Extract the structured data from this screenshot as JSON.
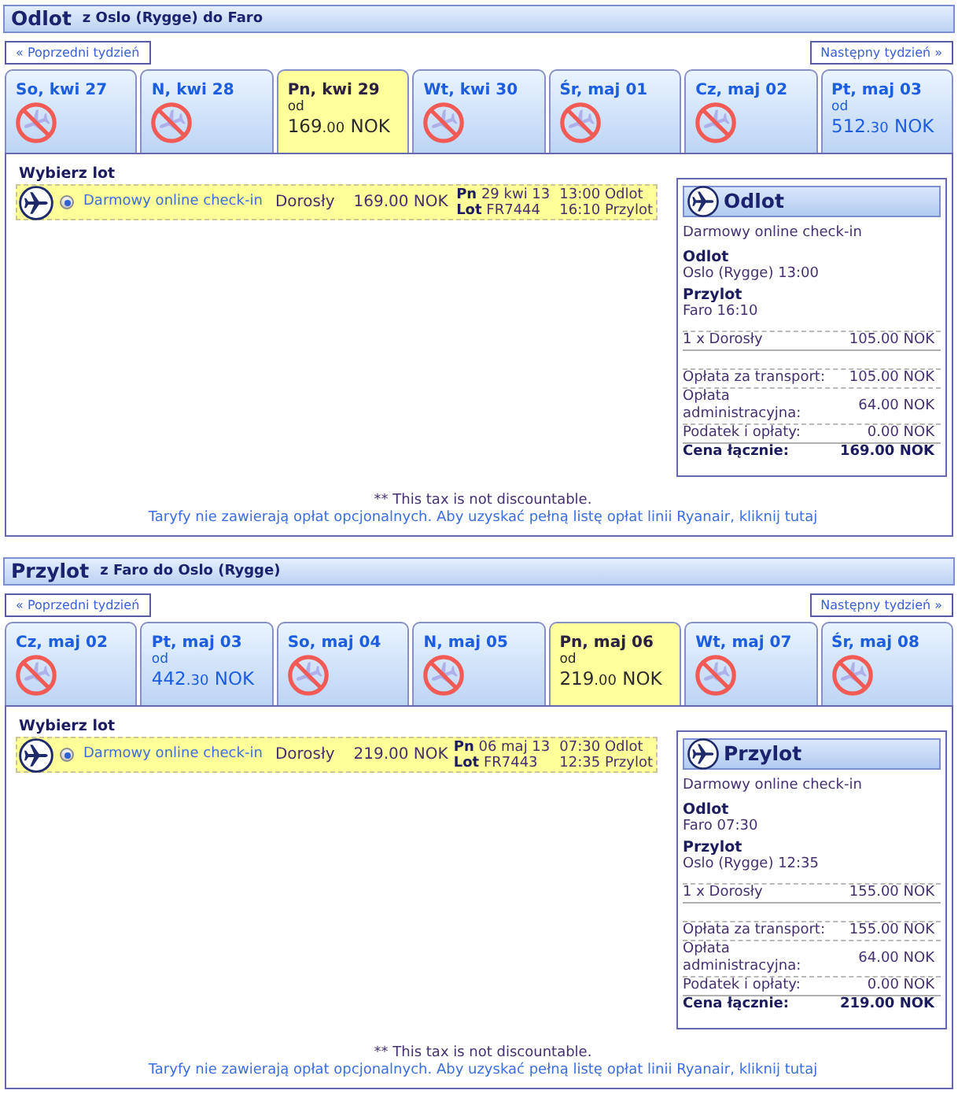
{
  "sections": [
    {
      "title": "Odlot",
      "route": "z Oslo (Rygge) do Faro",
      "prev_week": "« Poprzedni tydzień",
      "next_week": "Następny tydzień »",
      "days": [
        {
          "label": "So, kwi 27",
          "kind": "no_flights",
          "selected": false
        },
        {
          "label": "N, kwi 28",
          "kind": "no_flights",
          "selected": false
        },
        {
          "label": "Pn, kwi 29",
          "kind": "fare",
          "selected": true,
          "from": "od",
          "price_main": "169",
          "price_cents": ".00",
          "currency": "NOK"
        },
        {
          "label": "Wt, kwi 30",
          "kind": "no_flights",
          "selected": false
        },
        {
          "label": "Śr, maj 01",
          "kind": "no_flights",
          "selected": false
        },
        {
          "label": "Cz, maj 02",
          "kind": "no_flights",
          "selected": false
        },
        {
          "label": "Pt, maj 03",
          "kind": "fare",
          "selected": false,
          "from": "od",
          "price_main": "512",
          "price_cents": ".30",
          "currency": "NOK"
        }
      ],
      "flights_heading": "Wybierz lot",
      "flights": [
        {
          "selected": true,
          "fare_name": "Darmowy online check-in",
          "passenger": "Dorosły",
          "price": "169.00 NOK",
          "date": "**Pn** 29 kwi 13",
          "departure": "13:00 Odlot",
          "flight_no": "**Lot** FR7444",
          "arrival": "16:10 Przylot"
        }
      ],
      "summary": {
        "title": "Odlot",
        "fare_name": "Darmowy online check-in",
        "legs": [
          {
            "label": "Odlot",
            "value": "Oslo (Rygge) 13:00"
          },
          {
            "label": "Przylot",
            "value": "Faro 16:10"
          }
        ],
        "passengers": [
          {
            "label": "1 x Dorosły",
            "amount": "105.00 NOK"
          }
        ],
        "charges": [
          {
            "label": "Opłata za transport:",
            "amount": "105.00 NOK"
          },
          {
            "label": "Opłata administracyjna:",
            "amount": "64.00 NOK"
          },
          {
            "label": "Podatek i opłaty:",
            "amount": "0.00 NOK"
          }
        ],
        "total": {
          "label": "Cena łącznie:",
          "amount": "169.00 NOK"
        }
      },
      "tax_note": "** This tax is not discountable.",
      "fees_link": "Taryfy nie zawierają opłat opcjonalnych. Aby uzyskać pełną listę opłat linii Ryanair, kliknij tutaj"
    },
    {
      "title": "Przylot",
      "route": "z Faro do Oslo (Rygge)",
      "prev_week": "« Poprzedni tydzień",
      "next_week": "Następny tydzień »",
      "days": [
        {
          "label": "Cz, maj 02",
          "kind": "no_flights",
          "selected": false
        },
        {
          "label": "Pt, maj 03",
          "kind": "fare",
          "selected": false,
          "from": "od",
          "price_main": "442",
          "price_cents": ".30",
          "currency": "NOK"
        },
        {
          "label": "So, maj 04",
          "kind": "no_flights",
          "selected": false
        },
        {
          "label": "N, maj 05",
          "kind": "no_flights",
          "selected": false
        },
        {
          "label": "Pn, maj 06",
          "kind": "fare",
          "selected": true,
          "from": "od",
          "price_main": "219",
          "price_cents": ".00",
          "currency": "NOK"
        },
        {
          "label": "Wt, maj 07",
          "kind": "no_flights",
          "selected": false
        },
        {
          "label": "Śr, maj 08",
          "kind": "no_flights",
          "selected": false
        }
      ],
      "flights_heading": "Wybierz lot",
      "flights": [
        {
          "selected": true,
          "fare_name": "Darmowy online check-in",
          "passenger": "Dorosły",
          "price": "219.00 NOK",
          "date": "**Pn** 06 maj 13",
          "departure": "07:30 Odlot",
          "flight_no": "**Lot** FR7443",
          "arrival": "12:35 Przylot"
        }
      ],
      "summary": {
        "title": "Przylot",
        "fare_name": "Darmowy online check-in",
        "legs": [
          {
            "label": "Odlot",
            "value": "Faro 07:30"
          },
          {
            "label": "Przylot",
            "value": "Oslo (Rygge) 12:35"
          }
        ],
        "passengers": [
          {
            "label": "1 x Dorosły",
            "amount": "155.00 NOK"
          }
        ],
        "charges": [
          {
            "label": "Opłata za transport:",
            "amount": "155.00 NOK"
          },
          {
            "label": "Opłata administracyjna:",
            "amount": "64.00 NOK"
          },
          {
            "label": "Podatek i opłaty:",
            "amount": "0.00 NOK"
          }
        ],
        "total": {
          "label": "Cena łącznie:",
          "amount": "219.00 NOK"
        }
      },
      "tax_note": "** This tax is not discountable.",
      "fees_link": "Taryfy nie zawierają opłat opcjonalnych. Aby uzyskać pełną listę opłat linii Ryanair, kliknij tutaj"
    }
  ]
}
